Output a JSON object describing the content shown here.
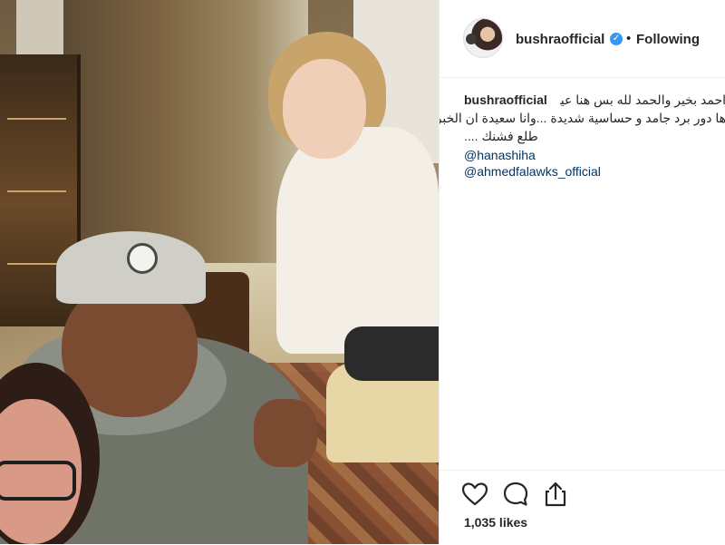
{
  "post": {
    "username": "bushraofficial",
    "verified_icon": "verified-badge-icon",
    "separator": "•",
    "follow_status": "Following"
  },
  "caption": {
    "username": "bushraofficial",
    "line1": "احمد بخير والحمد لله بس هنا عيانة و",
    "line2": "ها دور برد جامد و حساسية شديدة ...وانا سعيدة ان الخبر",
    "line3": "طلع فشنك ....",
    "mentions": [
      "@hanashiha",
      "@ahmedfalawks_official"
    ]
  },
  "actions": {
    "like_icon": "heart-icon",
    "comment_icon": "comment-icon",
    "share_icon": "share-icon"
  },
  "likes_text": "1,035 likes",
  "colors": {
    "accent_link": "#003569",
    "verified": "#3897f0",
    "border": "#efefef",
    "text": "#262626"
  }
}
